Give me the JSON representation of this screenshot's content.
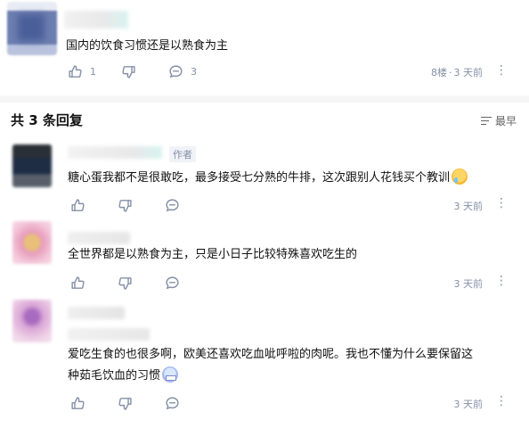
{
  "top_comment": {
    "text": "国内的饮食习惯还是以熟食为主",
    "like_count": "1",
    "reply_count": "3",
    "floor": "8楼",
    "dot": "·",
    "time": "3 天前",
    "more": "⋮"
  },
  "reply_header": {
    "title": "共 3 条回复",
    "sort_label": "最早"
  },
  "replies": [
    {
      "author_badge": "作者",
      "text": "糖心蛋我都不是很敢吃，最多接受七分熟的牛排，这次跟别人花钱买个教训",
      "emoji": "crying-face-emoji",
      "time": "3 天前"
    },
    {
      "text": "全世界都是以熟食为主，只是小日子比较特殊喜欢吃生的",
      "time": "3 天前"
    },
    {
      "text_line1": "爱吃生食的也很多啊，欧美还喜欢吃血呲呼啦的肉呢。我也不懂为什么要保留这",
      "text_line2": "种茹毛饮血的习惯",
      "emoji": "grimacing-face-emoji",
      "time": "3 天前"
    }
  ],
  "colors": {
    "text": "#121212",
    "muted": "#8590a6",
    "divider": "#f6f6f6"
  }
}
